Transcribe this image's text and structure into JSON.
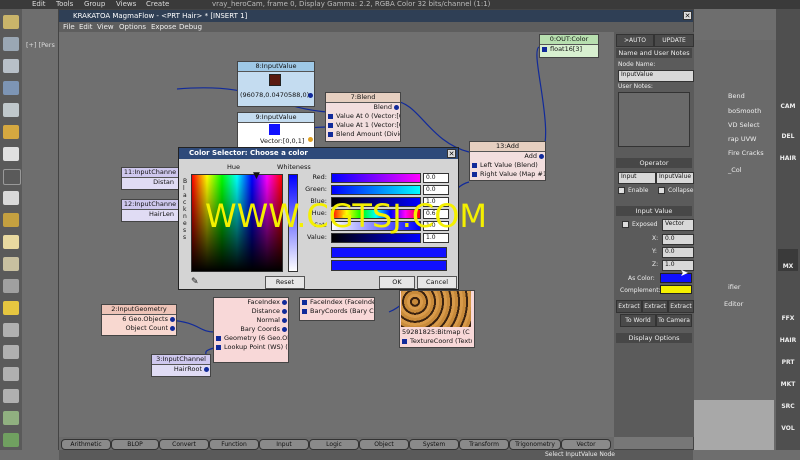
{
  "host": {
    "menu": [
      "Edit",
      "Tools",
      "Group",
      "Views",
      "Create"
    ],
    "title_fragment": "vray_heroCam, frame 0, Display Gamma: 2.2, RGBA Color 32 bits/channel (1:1)"
  },
  "viewport_label": "[+] [Pers",
  "magma": {
    "title": "KRAKATOA MagmaFlow - <PRT Hair> * [INSERT 1]",
    "menu": [
      "File",
      "Edit",
      "View",
      "Options",
      "Expose",
      "Debug"
    ],
    "status": "Select InputValue Node"
  },
  "nodes": {
    "input8": {
      "title": "8:InputValue",
      "value": "(96078,0.0470588,0)"
    },
    "input9": {
      "title": "9:InputValue",
      "value": "Vector:[0,0,1]"
    },
    "blend7": {
      "title": "7:Blend",
      "out": "Blend",
      "rows": [
        "Value At 0 (Vector:[0",
        "Value At 1 (Vector:[0",
        "Blend Amount (Divide"
      ]
    },
    "add13": {
      "title": "13:Add",
      "out": "Add",
      "rows": [
        "Left Value (Blend)",
        "Right Value (Map #14"
      ]
    },
    "out0": {
      "title": "0:OUT:Color",
      "row": "float16[3]"
    },
    "ich11": {
      "title": "11:InputChanne",
      "row": "Distan"
    },
    "ich12": {
      "title": "12:InputChanne",
      "row": "HairLen"
    },
    "geo2": {
      "title": "2:InputGeometry",
      "rows": [
        "6 Geo.Objects",
        "Object Count"
      ]
    },
    "ich3": {
      "title": "3:InputChannel",
      "row": "HairRoot"
    },
    "pink": {
      "rows": [
        "FaceIndex",
        "Distance",
        "Normal",
        "Bary Coords",
        "Geometry (6 Geo.Ob",
        "Lookup Point (WS) (H"
      ]
    },
    "pink2": {
      "rows": [
        "FaceIndex (FaceInde",
        "BaryCoords (Bary Co"
      ]
    },
    "bitmap": {
      "rows": [
        "59281825:Bitmap (C",
        "TextureCoord (Textu"
      ]
    }
  },
  "color_selector": {
    "title": "Color Selector: Choose a color",
    "hue_label": "Hue",
    "whiteness_label": "Whiteness",
    "blackness_label": "B l a c k n e s s",
    "channels": [
      {
        "label": "Red:",
        "value": "0.0"
      },
      {
        "label": "Green:",
        "value": "0.0"
      },
      {
        "label": "Blue:",
        "value": "1.0"
      },
      {
        "label": "Hue:",
        "value": "0.6"
      },
      {
        "label": "Sat:",
        "value": "1.0"
      },
      {
        "label": "Value:",
        "value": "1.0"
      }
    ],
    "reset": "Reset",
    "ok": "OK",
    "cancel": "Cancel"
  },
  "panel": {
    "auto": ">AUTO",
    "update": "UPDATE",
    "name_section": "Name and User Notes",
    "node_name_label": "Node Name:",
    "node_name": "InputValue",
    "user_notes_label": "User Notes:",
    "operator_section": "Operator",
    "op_type": "Input",
    "op_value": "InputValue",
    "enable": "Enable",
    "collapse": "Collapse",
    "input_section": "Input Value",
    "exposed": "Exposed",
    "vector": "Vector",
    "x_label": "X:",
    "x": "0.0",
    "y_label": "Y:",
    "y": "0.0",
    "z_label": "Z:",
    "z": "1.0",
    "as_color": "As Color:",
    "complement": "Complement:",
    "extract": [
      "Extract X",
      "Extract Y",
      "Extract Z"
    ],
    "to_world": "To World",
    "to_camera": "To Camera",
    "display_options": "Display Options"
  },
  "right_toolbar": [
    "CAM",
    "DEL",
    "HAIR",
    "MX",
    "FFX",
    "HAIR",
    "PRT",
    "MKT",
    "SRC",
    "VOL"
  ],
  "bottom_tabs": [
    "Arithmetic",
    "BLOP",
    "Convert",
    "Function",
    "Input",
    "Logic",
    "Object",
    "System",
    "Transform",
    "Trigonometry",
    "Vector"
  ],
  "behind_panel": [
    "Bend",
    "boSmooth",
    "VD Select",
    "rap UVW",
    "Fire Cracks",
    "_Col",
    "ifier",
    "Editor"
  ],
  "watermark": "WWW.CGTSJ.COM",
  "colors": {
    "blue": "#1010ff",
    "yellow": "#f4f000",
    "node_blue": "#c4dcf0"
  }
}
